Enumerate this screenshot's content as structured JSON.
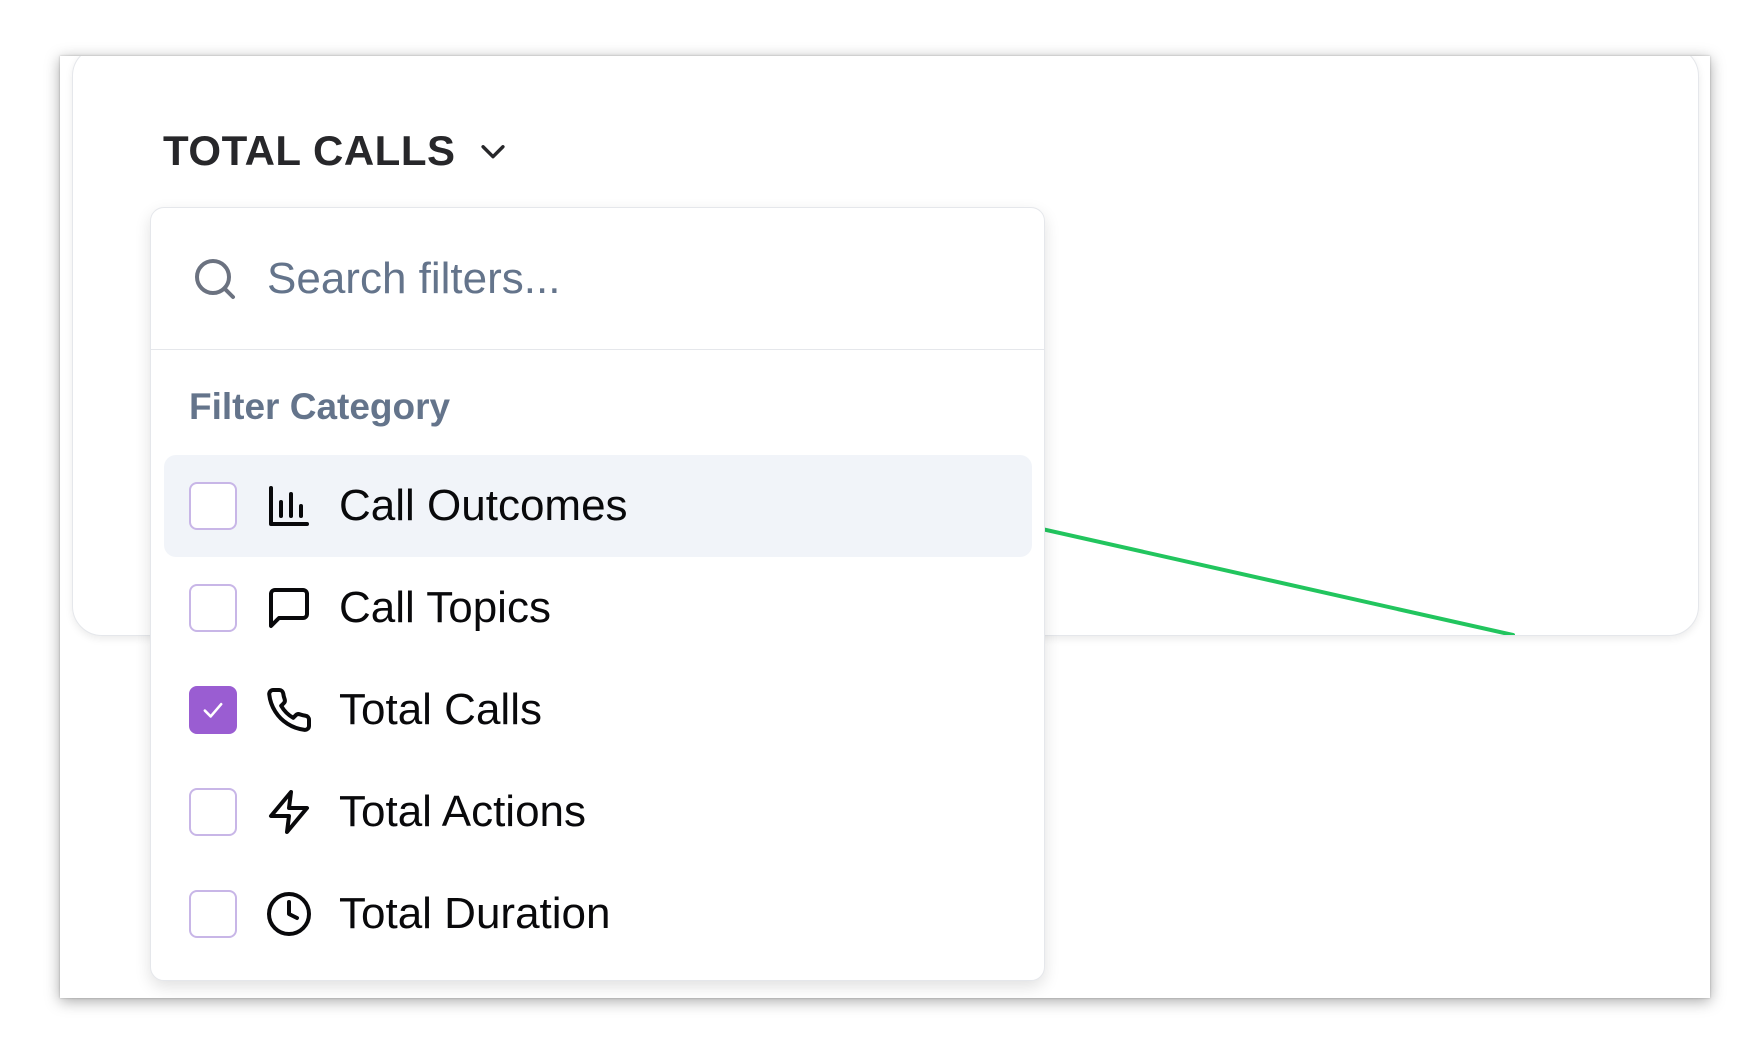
{
  "metric_selector": {
    "title": "TOTAL CALLS"
  },
  "filter_dropdown": {
    "search_placeholder": "Search filters...",
    "search_value": "",
    "category_label": "Filter Category",
    "items": [
      {
        "label": "Call Outcomes",
        "icon": "bar-chart-icon",
        "checked": false,
        "highlighted": true
      },
      {
        "label": "Call Topics",
        "icon": "message-square-icon",
        "checked": false,
        "highlighted": false
      },
      {
        "label": "Total Calls",
        "icon": "phone-icon",
        "checked": true,
        "highlighted": false
      },
      {
        "label": "Total Actions",
        "icon": "lightning-icon",
        "checked": false,
        "highlighted": false
      },
      {
        "label": "Total Duration",
        "icon": "clock-icon",
        "checked": false,
        "highlighted": false
      }
    ]
  },
  "colors": {
    "accent_purple": "#9a5dd2",
    "trend_line_green": "#22c55e",
    "highlight_bg": "#f1f4f9"
  }
}
